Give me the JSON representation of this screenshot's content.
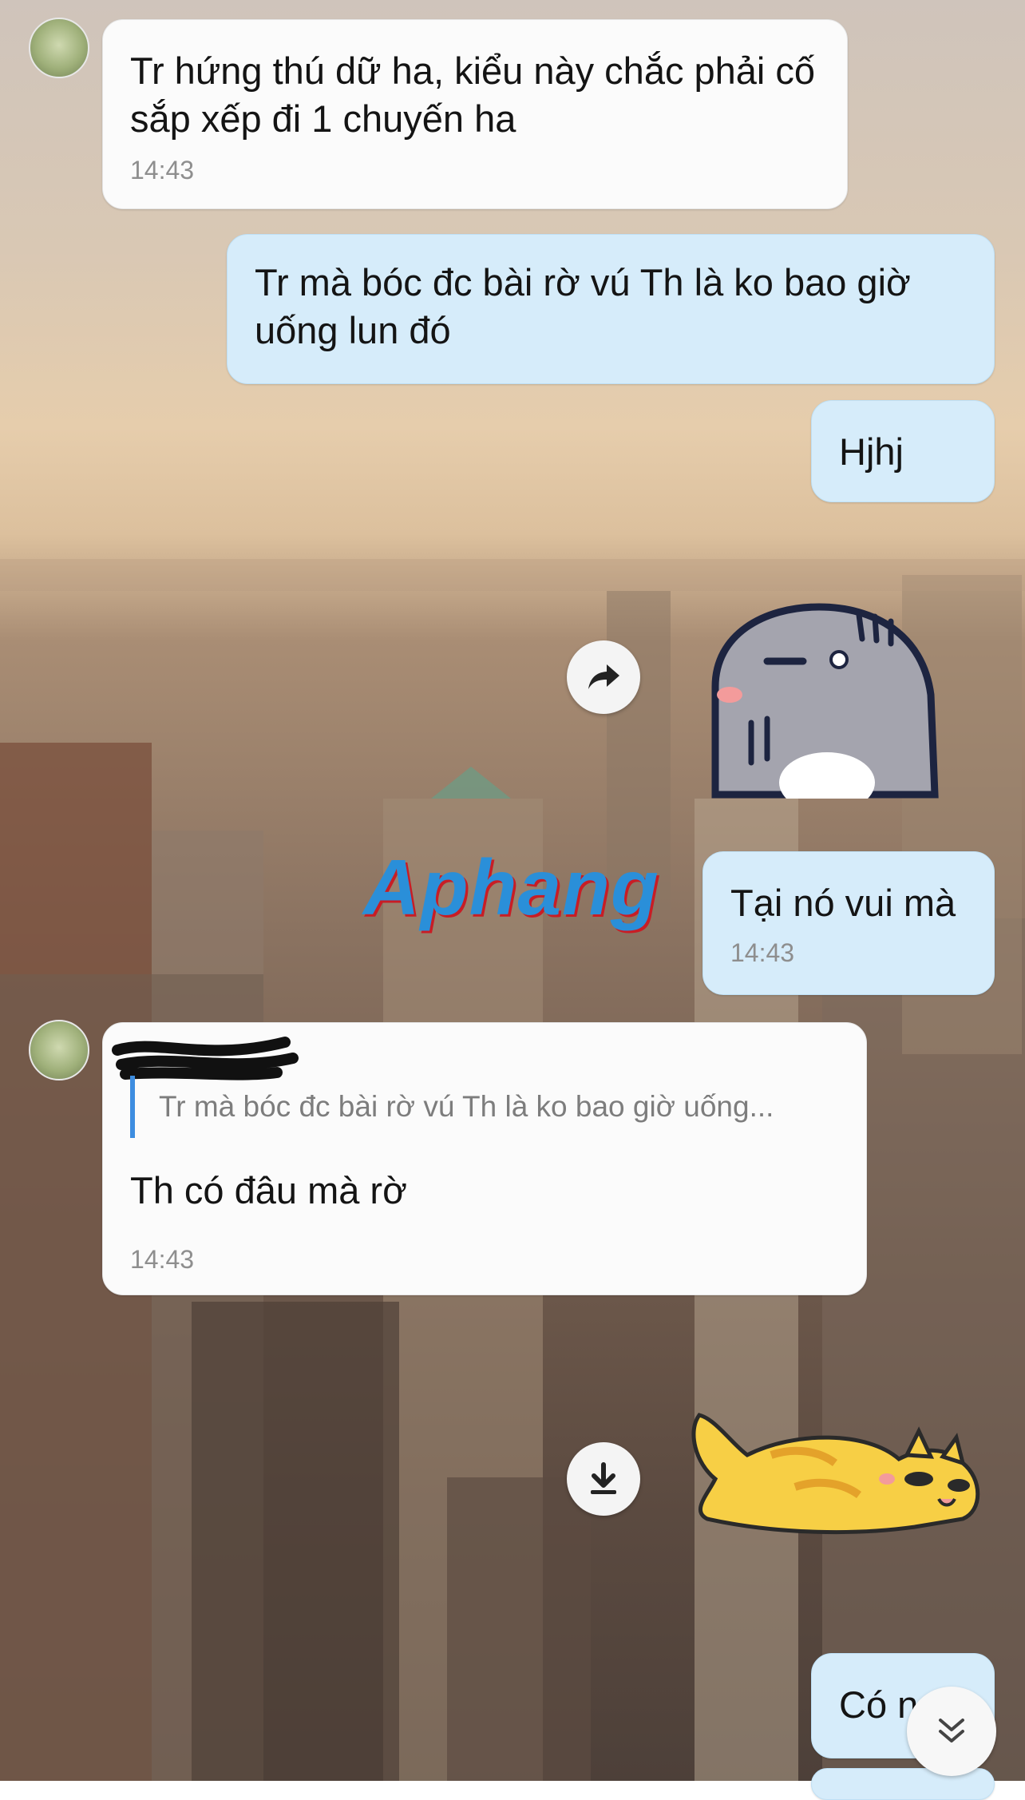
{
  "messages": [
    {
      "text": "Tr hứng thú dữ ha, kiểu này chắc phải cố sắp xếp đi 1 chuyến ha",
      "time": "14:43"
    },
    {
      "text": "Tr mà bóc đc bài rờ vú Th là ko bao giờ uống lun đó"
    },
    {
      "text": "Hjhj"
    },
    {
      "text": "Tại nó vui mà",
      "time": "14:43"
    },
    {
      "quote": "Tr mà bóc đc bài rờ vú Th là ko bao giờ uống...",
      "text": "Th có đâu mà rờ",
      "time": "14:43"
    },
    {
      "text": "Có n"
    }
  ],
  "watermark": "Aphang",
  "icons": {
    "forward": "share-arrow-icon",
    "download": "download-icon",
    "scroll": "chevron-double-down-icon"
  },
  "colors": {
    "incoming_bubble": "#fbfbfb",
    "outgoing_bubble": "#d6ecfa",
    "quote_bar": "#3d8de0"
  }
}
